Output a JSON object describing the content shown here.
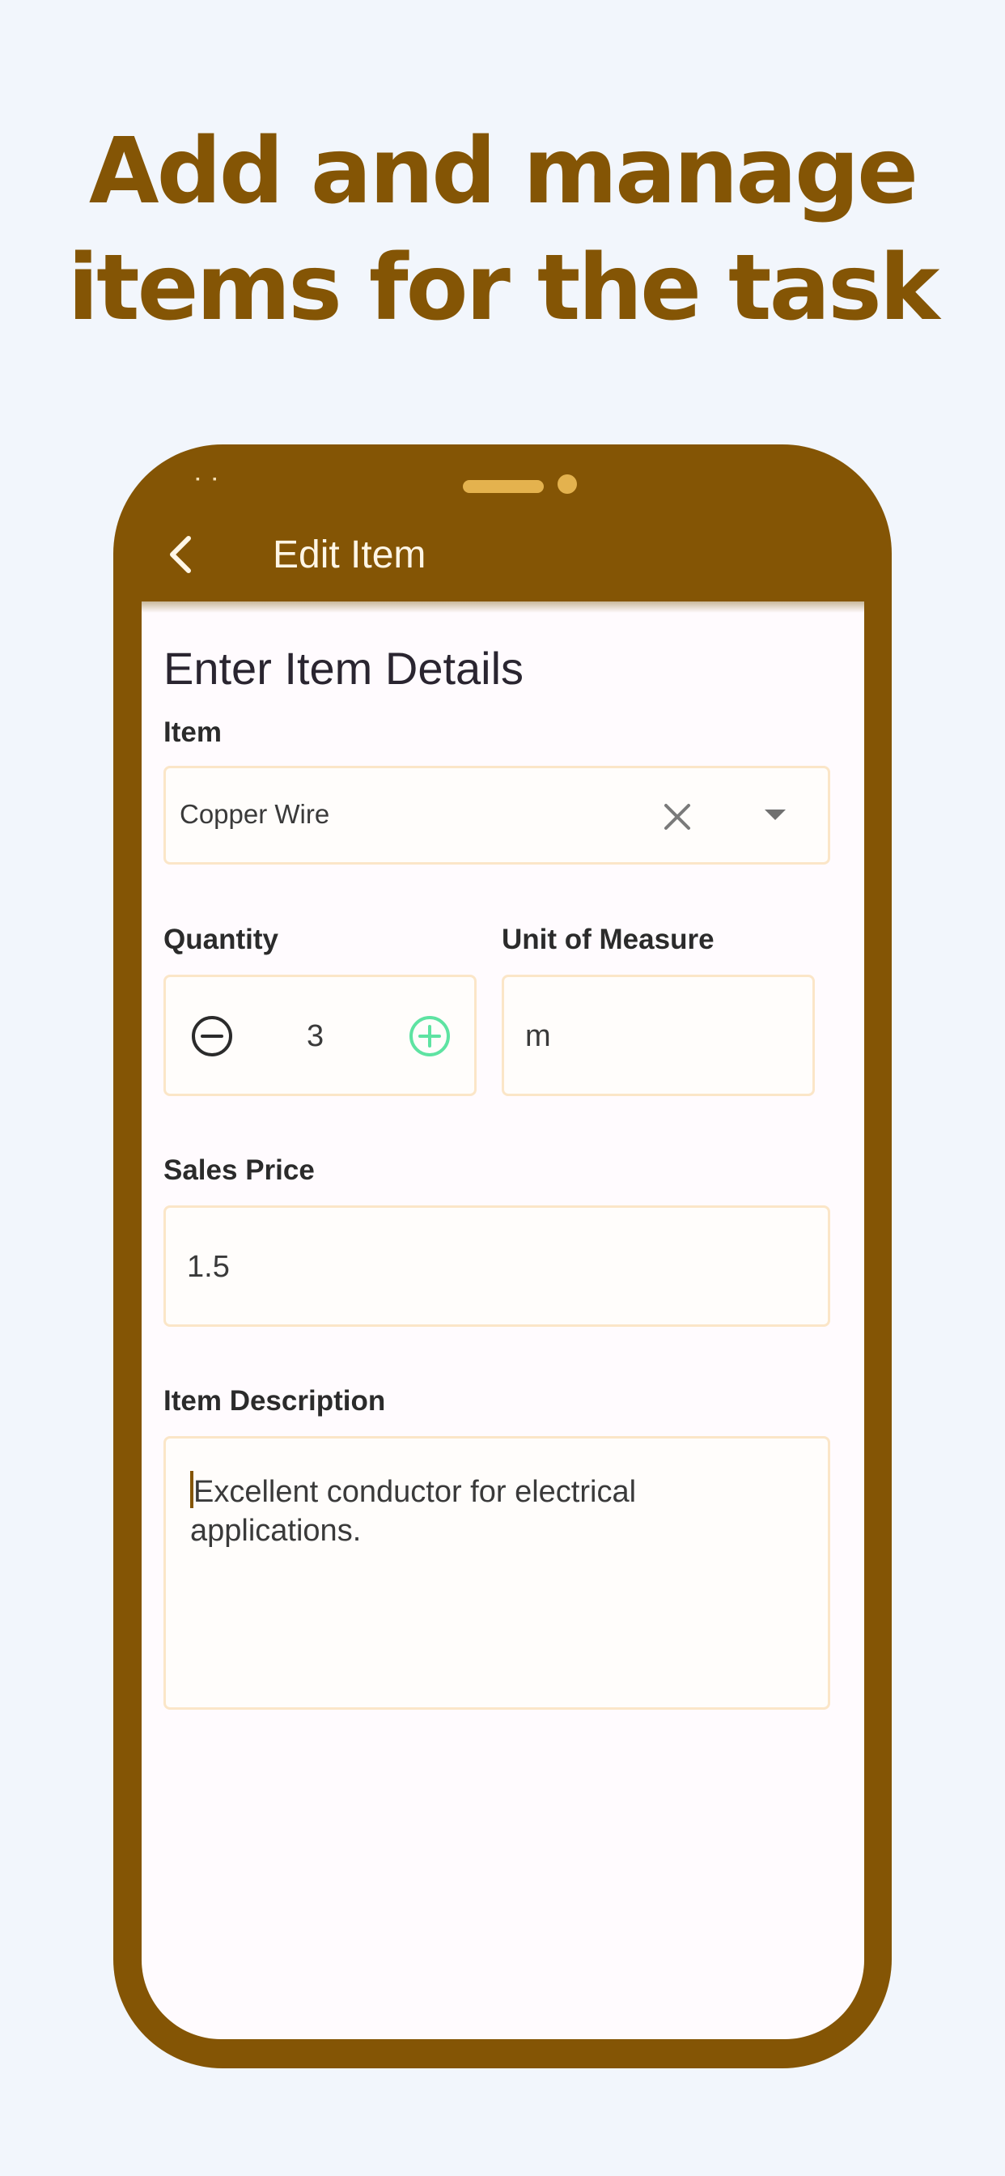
{
  "headline": {
    "line1": "Add and manage",
    "line2": "items for the task"
  },
  "appbar": {
    "title": "Edit Item"
  },
  "form": {
    "title": "Enter Item Details",
    "item": {
      "label": "Item",
      "value": "Copper Wire"
    },
    "quantity": {
      "label": "Quantity",
      "value": "3"
    },
    "unit": {
      "label": "Unit of Measure",
      "value": "m"
    },
    "price": {
      "label": "Sales Price",
      "value": "1.5"
    },
    "description": {
      "label": "Item Description",
      "value": "Excellent conductor for electrical applications."
    }
  },
  "icons": {
    "back": "chevron-left-icon",
    "clear": "close-icon",
    "dropdown": "caret-down-icon",
    "decrement": "minus-circle-icon",
    "increment": "plus-circle-icon"
  },
  "colors": {
    "brand": "#845505",
    "background": "#f2f6fc",
    "field_border": "#fbe6c8",
    "increment_accent": "#5ee3a2"
  }
}
